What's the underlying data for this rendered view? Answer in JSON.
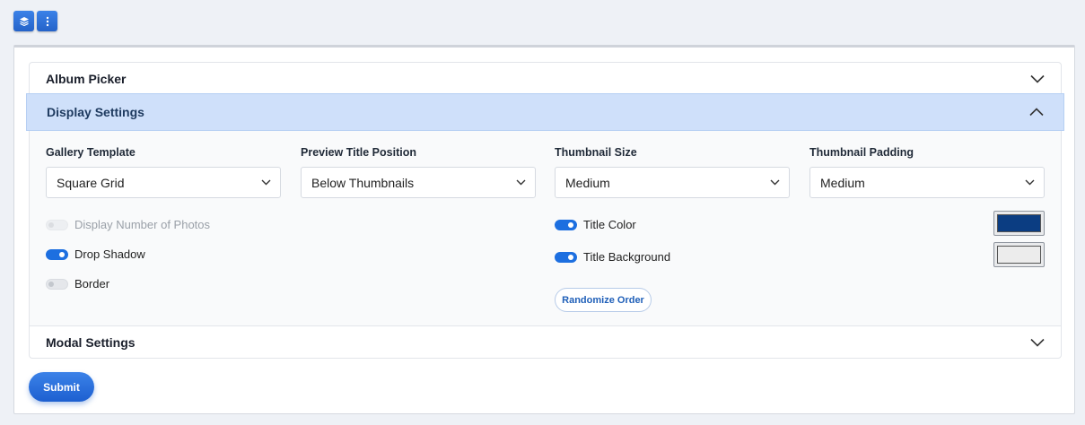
{
  "toolbar": {
    "layers_icon": "layers-icon",
    "more_icon": "kebab-vertical-icon"
  },
  "accordion": {
    "album_picker": {
      "title": "Album Picker"
    },
    "display_settings": {
      "title": "Display Settings",
      "expanded": true
    },
    "modal_settings": {
      "title": "Modal Settings"
    }
  },
  "display": {
    "fields": [
      {
        "label": "Gallery Template",
        "value": "Square Grid"
      },
      {
        "label": "Preview Title Position",
        "value": "Below Thumbnails"
      },
      {
        "label": "Thumbnail Size",
        "value": "Medium"
      },
      {
        "label": "Thumbnail Padding",
        "value": "Medium"
      }
    ],
    "toggles_left": [
      {
        "label": "Display Number of Photos",
        "on": false,
        "disabled": true
      },
      {
        "label": "Drop Shadow",
        "on": true,
        "disabled": false
      },
      {
        "label": "Border",
        "on": false,
        "disabled": false
      }
    ],
    "toggles_right": [
      {
        "label": "Title Color",
        "on": true,
        "swatch": "#0b3d82"
      },
      {
        "label": "Title Background",
        "on": true,
        "swatch": "#ececec"
      }
    ],
    "randomize_label": "Randomize Order"
  },
  "submit_label": "Submit",
  "colors": {
    "accent": "#1d6fe0",
    "header_highlight": "#cfe0fa"
  }
}
